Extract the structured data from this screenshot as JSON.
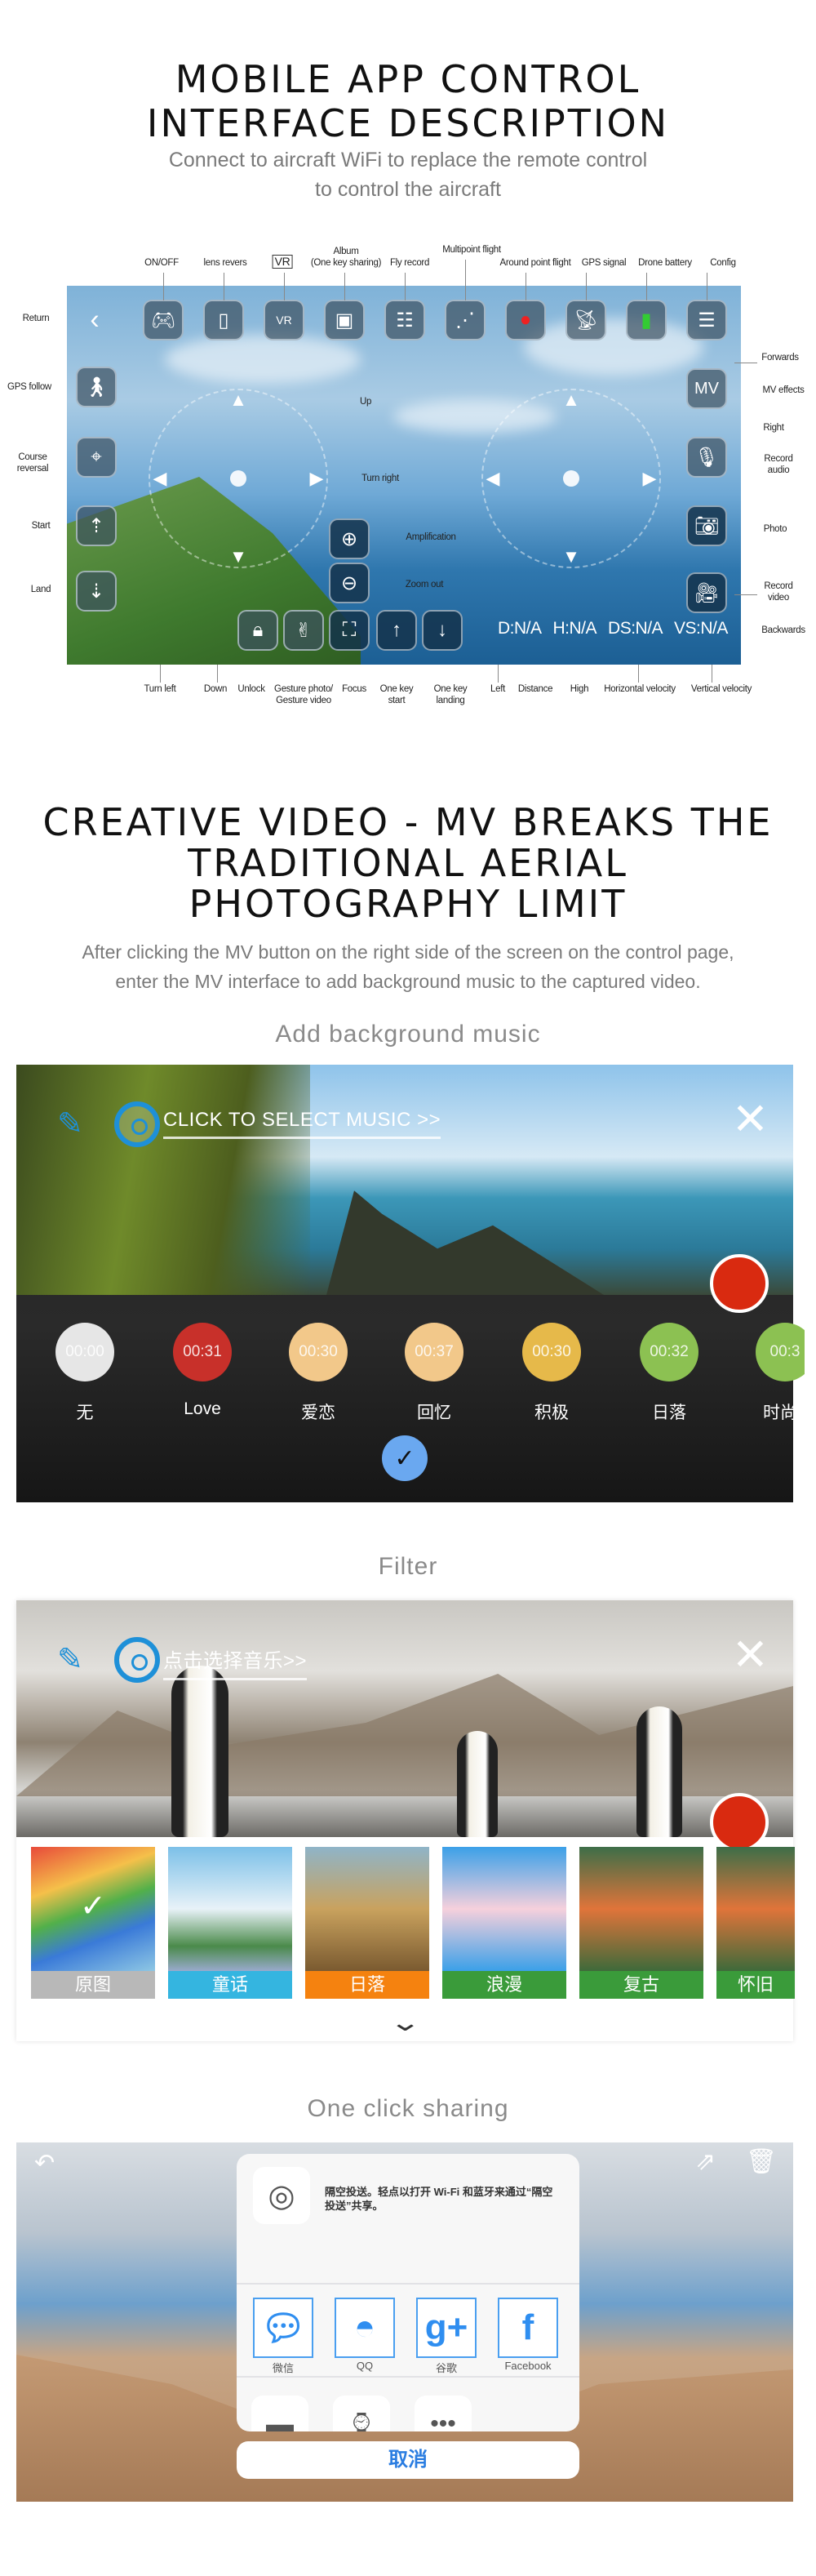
{
  "section1": {
    "title_line1": "MOBILE APP CONTROL",
    "title_line2": "INTERFACE DESCRIPTION",
    "subtitle_line1": "Connect to aircraft WiFi to replace the remote control",
    "subtitle_line2": "to control the aircraft",
    "labels": {
      "onoff": "ON/OFF",
      "lens": "lens revers",
      "vr": "VR",
      "album1": "Album",
      "album2": "(One key sharing)",
      "fly_record": "Fly record",
      "multipoint": "Multipoint flight",
      "around": "Around point flight",
      "gps_signal": "GPS signal",
      "battery": "Drone battery",
      "config": "Config",
      "return": "Return",
      "gps_follow": "GPS follow",
      "course1": "Course",
      "course2": "reversal",
      "start": "Start",
      "land": "Land",
      "forwards": "Forwards",
      "mv_effects": "MV effects",
      "right": "Right",
      "record_audio1": "Record",
      "record_audio2": "audio",
      "photo": "Photo",
      "record_video1": "Record",
      "record_video2": "video",
      "backwards": "Backwards",
      "up": "Up",
      "turn_right": "Turn right",
      "amplification": "Amplification",
      "zoom_out": "Zoom out",
      "turn_left": "Turn left",
      "down": "Down",
      "unlock": "Unlock",
      "gesture1": "Gesture photo/",
      "gesture2": "Gesture video",
      "focus": "Focus",
      "one_key_start1": "One key",
      "one_key_start2": "start",
      "one_key_landing1": "One key",
      "one_key_landing2": "landing",
      "left": "Left",
      "distance": "Distance",
      "high": "High",
      "h_velocity": "Horizontal velocity",
      "v_velocity": "Vertical velocity"
    },
    "mv_button": "MV",
    "telemetry": {
      "d": "D:N/A",
      "h": "H:N/A",
      "ds": "DS:N/A",
      "vs": "VS:N/A"
    }
  },
  "section2": {
    "title_line1": "CREATIVE VIDEO - MV BREAKS THE",
    "title_line2": "TRADITIONAL AERIAL",
    "title_line3": "PHOTOGRAPHY LIMIT",
    "subtitle_line1": "After clicking the MV button on the right side of the screen on the control page,",
    "subtitle_line2": "enter the MV interface to add background music to the captured video."
  },
  "music": {
    "heading": "Add background music",
    "select_text": "CLICK TO SELECT MUSIC >>",
    "items": [
      {
        "name": "无",
        "time": "00:00",
        "color": "#e6e6e6"
      },
      {
        "name": "Love",
        "time": "00:31",
        "color": "#c8302a"
      },
      {
        "name": "爱恋",
        "time": "00:30",
        "color": "#f2c88a"
      },
      {
        "name": "回忆",
        "time": "00:37",
        "color": "#f2c88a"
      },
      {
        "name": "积极",
        "time": "00:30",
        "color": "#e6b94a"
      },
      {
        "name": "日落",
        "time": "00:32",
        "color": "#8cc152"
      },
      {
        "name": "时尚",
        "time": "00:3",
        "color": "#8cc152"
      }
    ],
    "confirm_color": "#6aa8f0",
    "record_color": "#d92a10"
  },
  "filter": {
    "heading": "Filter",
    "select_text": "点击选择音乐>>",
    "items": [
      {
        "name": "原图",
        "color": "#b8b8b8",
        "selected": true
      },
      {
        "name": "童话",
        "color": "#34b5e0"
      },
      {
        "name": "日落",
        "color": "#f5820f"
      },
      {
        "name": "浪漫",
        "color": "#3a9b3a"
      },
      {
        "name": "复古",
        "color": "#3a9b3a"
      },
      {
        "name": "怀旧",
        "color": "#3a9b3a"
      }
    ]
  },
  "sharing": {
    "heading": "One click sharing",
    "airdrop_text_line1": "隔空投送。轻点以打开 Wi-Fi 和蓝牙来通过“隔空",
    "airdrop_text_line2": "投送”共享。",
    "apps": [
      {
        "name": "微信",
        "icon": "wechat-icon"
      },
      {
        "name": "QQ",
        "icon": "qq-icon"
      },
      {
        "name": "谷歌",
        "icon": "google-plus-icon"
      },
      {
        "name": "Facebook",
        "icon": "facebook-icon"
      }
    ],
    "cancel": "取消",
    "cancel_color": "#2a7de1"
  }
}
